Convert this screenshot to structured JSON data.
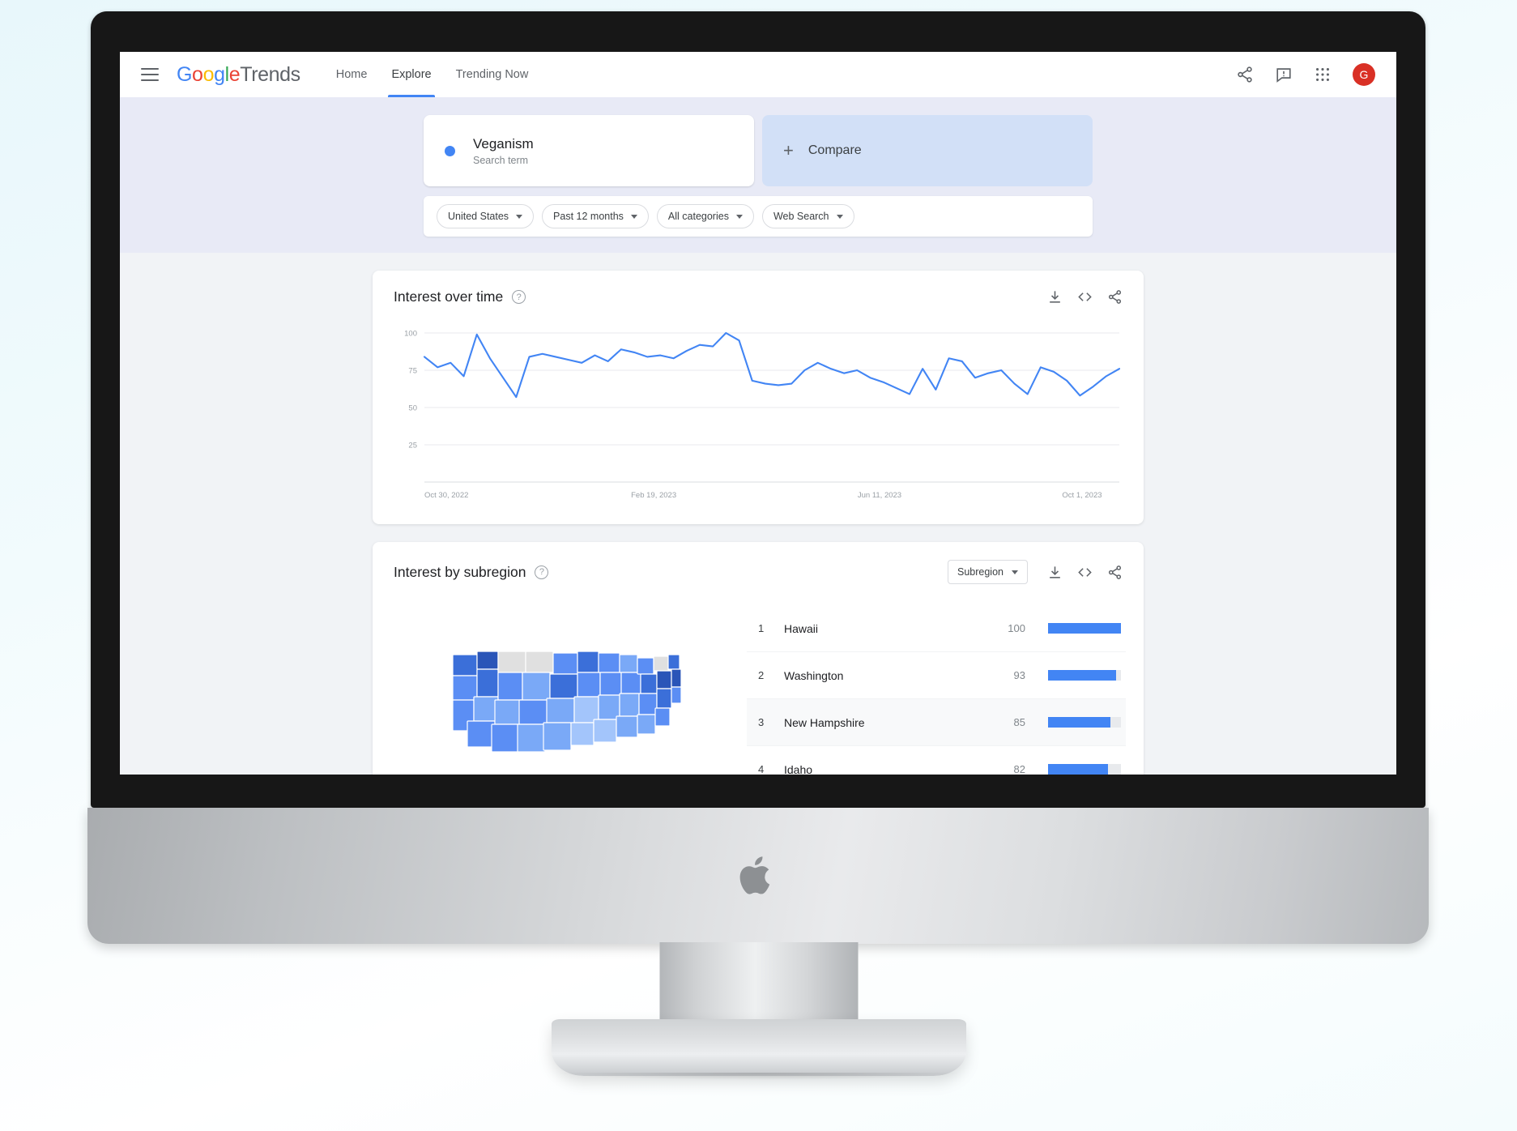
{
  "brand": {
    "g1": "G",
    "o1": "o",
    "o2": "o",
    "g2": "g",
    "l": "l",
    "e": "e",
    "product": "Trends"
  },
  "nav": [
    {
      "label": "Home",
      "active": false
    },
    {
      "label": "Explore",
      "active": true
    },
    {
      "label": "Trending Now",
      "active": false
    }
  ],
  "topright": {
    "share_icon": "share-icon",
    "feedback_icon": "feedback-icon",
    "apps_icon": "apps-grid-icon",
    "avatar_letter": "G",
    "avatar_color": "#d93025"
  },
  "query": {
    "term": "Veganism",
    "term_type": "Search term",
    "term_color": "#4285F4",
    "compare_label": "Compare",
    "compare_plus": "+"
  },
  "filters": [
    {
      "label": "United States"
    },
    {
      "label": "Past 12 months"
    },
    {
      "label": "All categories"
    },
    {
      "label": "Web Search"
    }
  ],
  "interest_over_time": {
    "title": "Interest over time",
    "help": "?",
    "actions": [
      "download-icon",
      "embed-icon",
      "share-icon"
    ]
  },
  "interest_by_subregion": {
    "title": "Interest by subregion",
    "help": "?",
    "select_label": "Subregion",
    "actions": [
      "download-icon",
      "embed-icon",
      "share-icon"
    ],
    "rows": [
      {
        "rank": "1",
        "name": "Hawaii",
        "value": "100",
        "pct": 100
      },
      {
        "rank": "2",
        "name": "Washington",
        "value": "93",
        "pct": 93
      },
      {
        "rank": "3",
        "name": "New Hampshire",
        "value": "85",
        "pct": 85,
        "highlight": true
      },
      {
        "rank": "4",
        "name": "Idaho",
        "value": "82",
        "pct": 82
      }
    ]
  },
  "chart_data": {
    "type": "line",
    "title": "Interest over time",
    "xlabel": "",
    "ylabel": "",
    "ylim": [
      0,
      100
    ],
    "yticks": [
      25,
      50,
      75,
      100
    ],
    "xtick_labels": [
      "Oct 30, 2022",
      "Feb 19, 2023",
      "Jun 11, 2023",
      "Oct 1, 2023"
    ],
    "xtick_positions": [
      0,
      0.33,
      0.655,
      0.975
    ],
    "grid": true,
    "legend": "none",
    "series": [
      {
        "name": "Veganism",
        "color": "#4285F4",
        "values": [
          84,
          77,
          80,
          71,
          99,
          83,
          70,
          57,
          84,
          86,
          84,
          82,
          80,
          85,
          81,
          89,
          87,
          84,
          85,
          83,
          88,
          92,
          91,
          100,
          95,
          68,
          66,
          65,
          66,
          75,
          80,
          76,
          73,
          75,
          70,
          67,
          63,
          59,
          76,
          62,
          83,
          81,
          70,
          73,
          75,
          66,
          59,
          77,
          74,
          68,
          58,
          64,
          71,
          76
        ]
      }
    ]
  },
  "map": {
    "name": "united-states-choropleth",
    "no_data_color": "#e0e0e0",
    "scale": [
      "#c6dafc",
      "#a3c5fb",
      "#7aa9f7",
      "#5b8ef4",
      "#3b6fd9",
      "#2a55b8"
    ]
  }
}
